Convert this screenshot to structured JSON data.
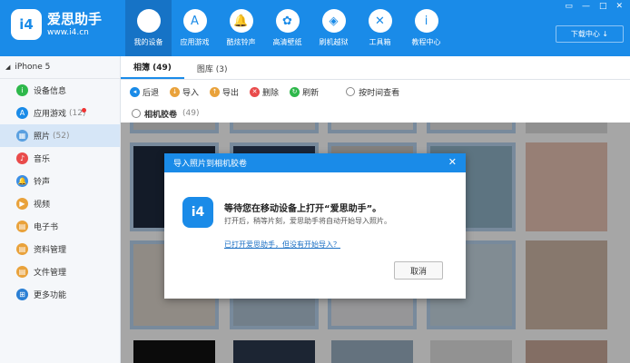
{
  "app": {
    "name": "爱思助手",
    "url": "www.i4.cn",
    "logo_text": "i4"
  },
  "nav": [
    {
      "label": "我的设备",
      "icon": "apple-icon",
      "glyph": "",
      "active": true
    },
    {
      "label": "应用游戏",
      "icon": "app-store-icon",
      "glyph": "A"
    },
    {
      "label": "酷炫铃声",
      "icon": "bell-icon",
      "glyph": "🔔"
    },
    {
      "label": "高清壁纸",
      "icon": "flower-icon",
      "glyph": "✿"
    },
    {
      "label": "刷机越狱",
      "icon": "box-icon",
      "glyph": "◈"
    },
    {
      "label": "工具箱",
      "icon": "tools-icon",
      "glyph": "✕"
    },
    {
      "label": "教程中心",
      "icon": "info-icon",
      "glyph": "i"
    }
  ],
  "window_controls": [
    "▭",
    "—",
    "□",
    "✕"
  ],
  "download_center": "下载中心 ↓",
  "sidebar": {
    "device": "iPhone 5",
    "items": [
      {
        "label": "设备信息",
        "count": "",
        "color": "#2eb84b",
        "glyph": "i"
      },
      {
        "label": "应用游戏",
        "count": "(12)",
        "color": "#1a8be8",
        "glyph": "A"
      },
      {
        "label": "照片",
        "count": "(52)",
        "color": "#5aa0e0",
        "glyph": "▦"
      },
      {
        "label": "音乐",
        "count": "",
        "color": "#e94b4b",
        "glyph": "♪"
      },
      {
        "label": "铃声",
        "count": "",
        "color": "#3a8ee6",
        "glyph": "🔔"
      },
      {
        "label": "视频",
        "count": "",
        "color": "#e9a23b",
        "glyph": "▶"
      },
      {
        "label": "电子书",
        "count": "",
        "color": "#e9a23b",
        "glyph": "▤"
      },
      {
        "label": "资料管理",
        "count": "",
        "color": "#e9a23b",
        "glyph": "▤"
      },
      {
        "label": "文件管理",
        "count": "",
        "color": "#e9a23b",
        "glyph": "▤"
      },
      {
        "label": "更多功能",
        "count": "",
        "color": "#2a7fd4",
        "glyph": "⊞"
      }
    ]
  },
  "tabs": [
    {
      "label": "相簿 (49)",
      "active": true
    },
    {
      "label": "图库 (3)"
    }
  ],
  "toolbar": [
    {
      "label": "后退",
      "color": "#1a8be8",
      "glyph": "◂"
    },
    {
      "label": "导入",
      "color": "#e9a23b",
      "glyph": "↓"
    },
    {
      "label": "导出",
      "color": "#e9a23b",
      "glyph": "↑"
    },
    {
      "label": "删除",
      "color": "#e94b4b",
      "glyph": "✕"
    },
    {
      "label": "刷新",
      "color": "#2eb84b",
      "glyph": "↻"
    }
  ],
  "sort_option": "按时间查看",
  "album": {
    "label": "相机胶卷",
    "count": "(49)"
  },
  "dialog": {
    "title": "导入照片到相机胶卷",
    "close": "✕",
    "heading": "等待您在移动设备上打开“爱思助手”。",
    "subtext": "打开后，稍等片刻，爱思助手将自动开始导入照片。",
    "link": "已打开爱思助手，但没有开始导入？",
    "cancel": "取消"
  }
}
